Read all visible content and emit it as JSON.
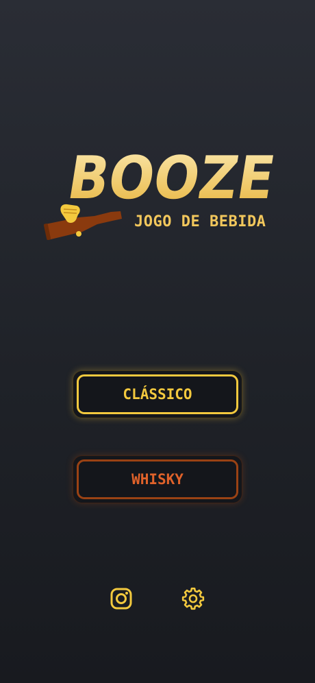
{
  "app": {
    "logo_text": "BOOZE",
    "subtitle": "JOGO DE BEBIDA"
  },
  "modes": [
    {
      "label": "CLÁSSICO",
      "color": "#f3c93e"
    },
    {
      "label": "WHISKY",
      "color": "#e0622a"
    }
  ],
  "footer": {
    "icons": [
      "instagram-icon",
      "gear-icon"
    ]
  },
  "colors": {
    "gold": "#f3c93e",
    "bottle": "#8a3a0e",
    "background": "#22252c"
  }
}
